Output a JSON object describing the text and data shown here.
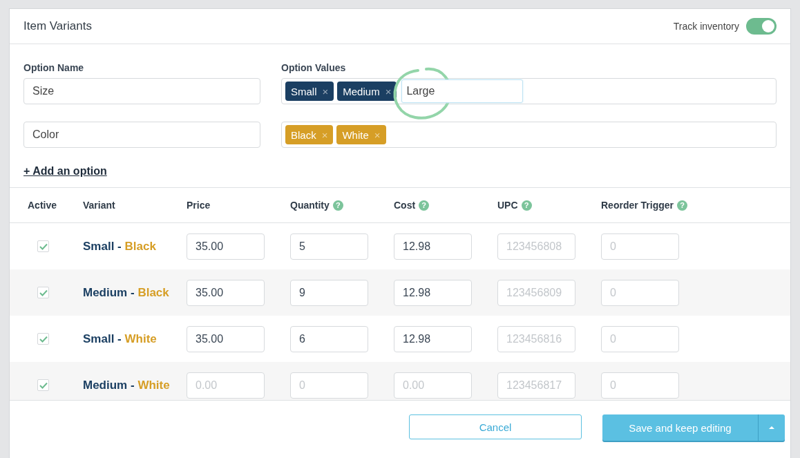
{
  "header": {
    "title": "Item Variants",
    "track_label": "Track inventory",
    "track_on": true
  },
  "options": {
    "name_label": "Option Name",
    "values_label": "Option Values",
    "rows": [
      {
        "name": "Size",
        "color": "#1b3f62",
        "values": [
          "Small",
          "Medium"
        ],
        "remove": "×",
        "new_value": "Large"
      },
      {
        "name": "Color",
        "color": "#d69e26",
        "values": [
          "Black",
          "White"
        ],
        "remove": "×"
      }
    ],
    "add_link": "+ Add an option"
  },
  "table": {
    "columns": [
      {
        "label": "Active"
      },
      {
        "label": "Variant"
      },
      {
        "label": "Price"
      },
      {
        "label": "Quantity",
        "help": "?"
      },
      {
        "label": "Cost",
        "help": "?"
      },
      {
        "label": "UPC",
        "help": "?"
      },
      {
        "label": "Reorder Trigger",
        "help": "?"
      }
    ],
    "rows": [
      {
        "active": true,
        "size": "Small",
        "separator": "-",
        "color_name": "Black",
        "fields": [
          {
            "value": "35.00"
          },
          {
            "value": "5"
          },
          {
            "value": "12.98"
          },
          {
            "placeholder": "123456808"
          },
          {
            "placeholder": "0"
          }
        ]
      },
      {
        "active": true,
        "size": "Medium",
        "separator": "-",
        "color_name": "Black",
        "fields": [
          {
            "value": "35.00"
          },
          {
            "value": "9"
          },
          {
            "value": "12.98"
          },
          {
            "placeholder": "123456809"
          },
          {
            "placeholder": "0"
          }
        ]
      },
      {
        "active": true,
        "size": "Small",
        "separator": "-",
        "color_name": "White",
        "fields": [
          {
            "value": "35.00"
          },
          {
            "value": "6"
          },
          {
            "value": "12.98"
          },
          {
            "placeholder": "123456816"
          },
          {
            "placeholder": "0"
          }
        ]
      },
      {
        "active": true,
        "size": "Medium",
        "separator": "-",
        "color_name": "White",
        "fields": [
          {
            "placeholder": "0.00"
          },
          {
            "placeholder": "0"
          },
          {
            "placeholder": "0.00"
          },
          {
            "placeholder": "123456817"
          },
          {
            "placeholder": "0"
          }
        ]
      }
    ]
  },
  "footer": {
    "cancel": "Cancel",
    "save": "Save and keep editing"
  }
}
